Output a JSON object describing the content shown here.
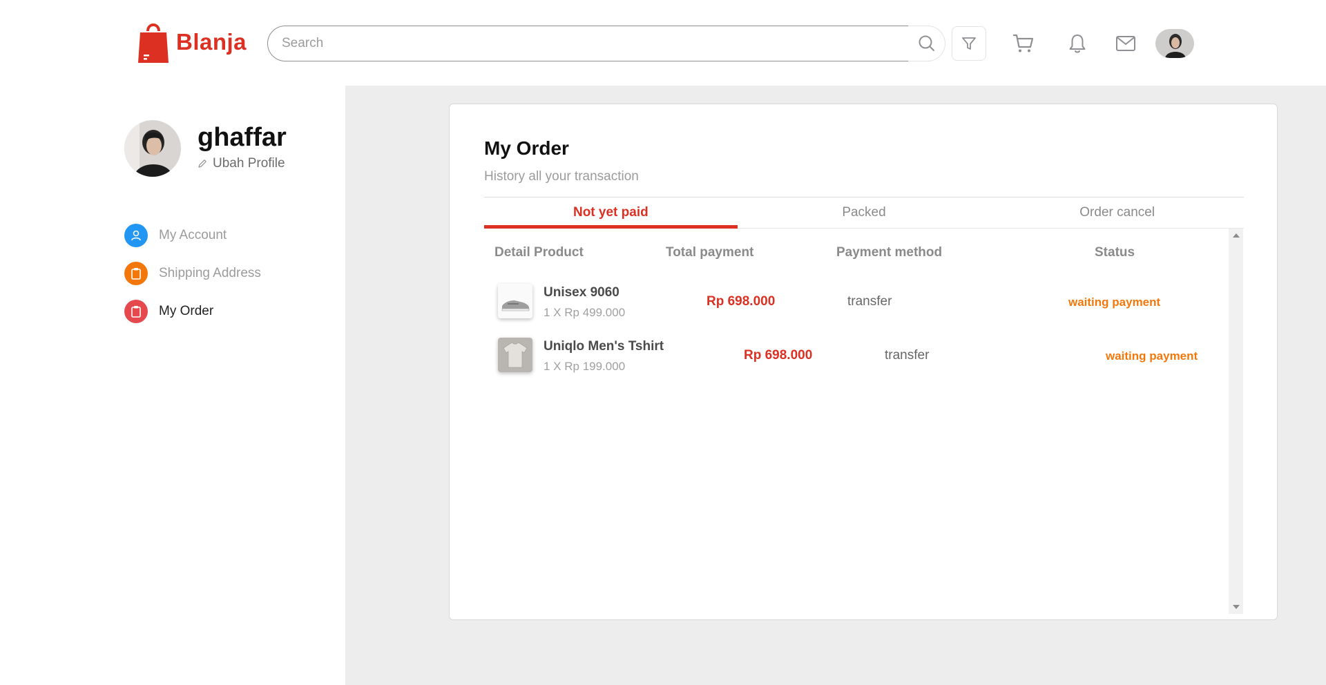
{
  "brand": {
    "name": "Blanja",
    "color": "#DB3022"
  },
  "search": {
    "placeholder": "Search",
    "value": ""
  },
  "header_icons": [
    "search-icon",
    "filter-icon",
    "cart-icon",
    "bell-icon",
    "mail-icon"
  ],
  "profile": {
    "name": "ghaffar",
    "edit_label": "Ubah Profile"
  },
  "sidebar": {
    "items": [
      {
        "label": "My Account",
        "icon": "user-icon",
        "color": "#2196F3",
        "active": false
      },
      {
        "label": "Shipping Address",
        "icon": "clipboard-icon",
        "color": "#F2780C",
        "active": false
      },
      {
        "label": "My Order",
        "icon": "clipboard-icon",
        "color": "#E5484D",
        "active": true
      }
    ]
  },
  "order": {
    "title": "My Order",
    "subtitle": "History all your transaction",
    "tabs": [
      {
        "label": "Not yet paid",
        "active": true
      },
      {
        "label": "Packed",
        "active": false
      },
      {
        "label": "Order cancel",
        "active": false
      }
    ],
    "columns": [
      "Detail Product",
      "Total payment",
      "Payment method",
      "Status"
    ],
    "rows": [
      {
        "name": "Unisex 9060",
        "qty": "1 X Rp 499.000",
        "total": "Rp 698.000",
        "method": "transfer",
        "status": "waiting payment",
        "image": "sneaker-image"
      },
      {
        "name": "Uniqlo Men's Tshirt",
        "qty": "1 X Rp 199.000",
        "total": "Rp 698.000",
        "method": "transfer",
        "status": "waiting payment",
        "image": "tshirt-image"
      }
    ]
  },
  "colors": {
    "accent": "#DB3022",
    "status": "#F2780C",
    "muted": "#9B9B9B",
    "main_bg": "#EDEDED"
  }
}
